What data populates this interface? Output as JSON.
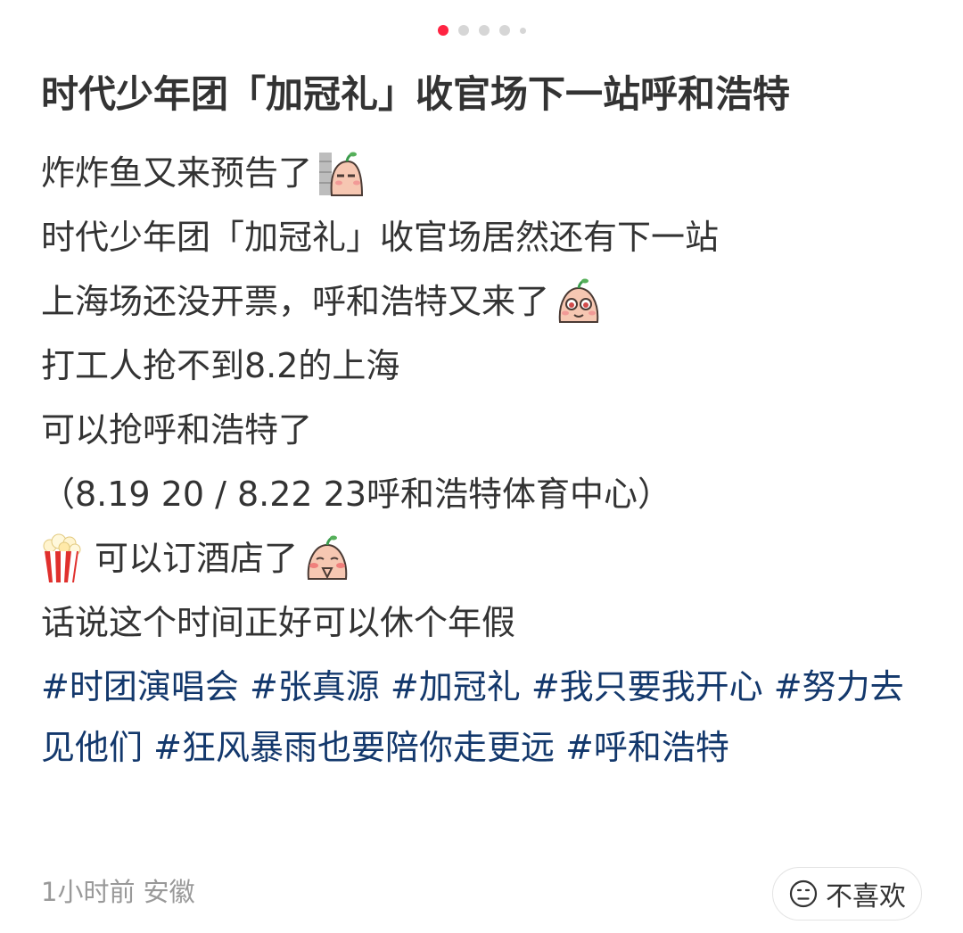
{
  "carousel": {
    "total": 5,
    "active_index": 0
  },
  "title": "时代少年团「加冠礼」收官场下一站呼和浩特",
  "body": {
    "line1": "炸炸鱼又来预告了",
    "line1_emoji": "peeking-peach-sticker",
    "line2": "时代少年团「加冠礼」收官场居然还有下一站",
    "line3": "上海场还没开票，呼和浩特又来了",
    "line3_emoji": "teary-eyed-peach-sticker",
    "line4": "打工人抢不到8.2的上海",
    "line5": "可以抢呼和浩特了",
    "line6": "（8.19 20 / 8.22 23呼和浩特体育中心）",
    "line7_emoji": "popcorn-emoji",
    "line7": "可以订酒店了",
    "line7_emoji2": "praying-peach-sticker",
    "line8": "话说这个时间正好可以休个年假"
  },
  "tags": [
    "#时团演唱会",
    "#张真源",
    "#加冠礼",
    "#我只要我开心",
    "#努力去见他们",
    "#狂风暴雨也要陪你走更远",
    "#呼和浩特"
  ],
  "meta": {
    "time": "1小时前",
    "location": "安徽"
  },
  "dislike": {
    "label": "不喜欢",
    "icon": "frown-face-icon"
  },
  "colors": {
    "accent": "#ff2442",
    "tag": "#13386c",
    "text": "#333333",
    "muted": "#999999"
  }
}
